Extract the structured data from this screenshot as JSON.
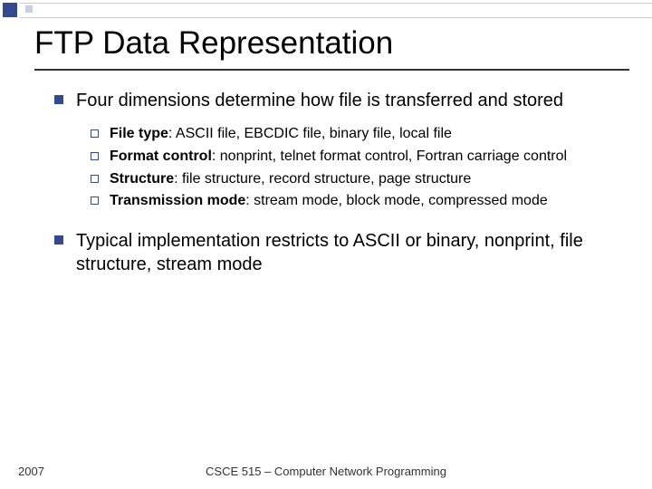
{
  "title": "FTP Data Representation",
  "points": [
    {
      "text": "Four dimensions determine how file is transferred and stored",
      "sub": [
        {
          "label": "File type",
          "rest": ": ASCII file, EBCDIC file, binary file, local file"
        },
        {
          "label": "Format control",
          "rest": ": nonprint, telnet format control, Fortran carriage control"
        },
        {
          "label": "Structure",
          "rest": ": file structure, record structure, page structure"
        },
        {
          "label": "Transmission mode",
          "rest": ": stream mode, block mode, compressed mode"
        }
      ]
    },
    {
      "text": "Typical implementation restricts to ASCII or binary, nonprint, file structure, stream mode",
      "sub": []
    }
  ],
  "footer": {
    "year": "2007",
    "course": "CSCE 515 – Computer Network Programming"
  }
}
